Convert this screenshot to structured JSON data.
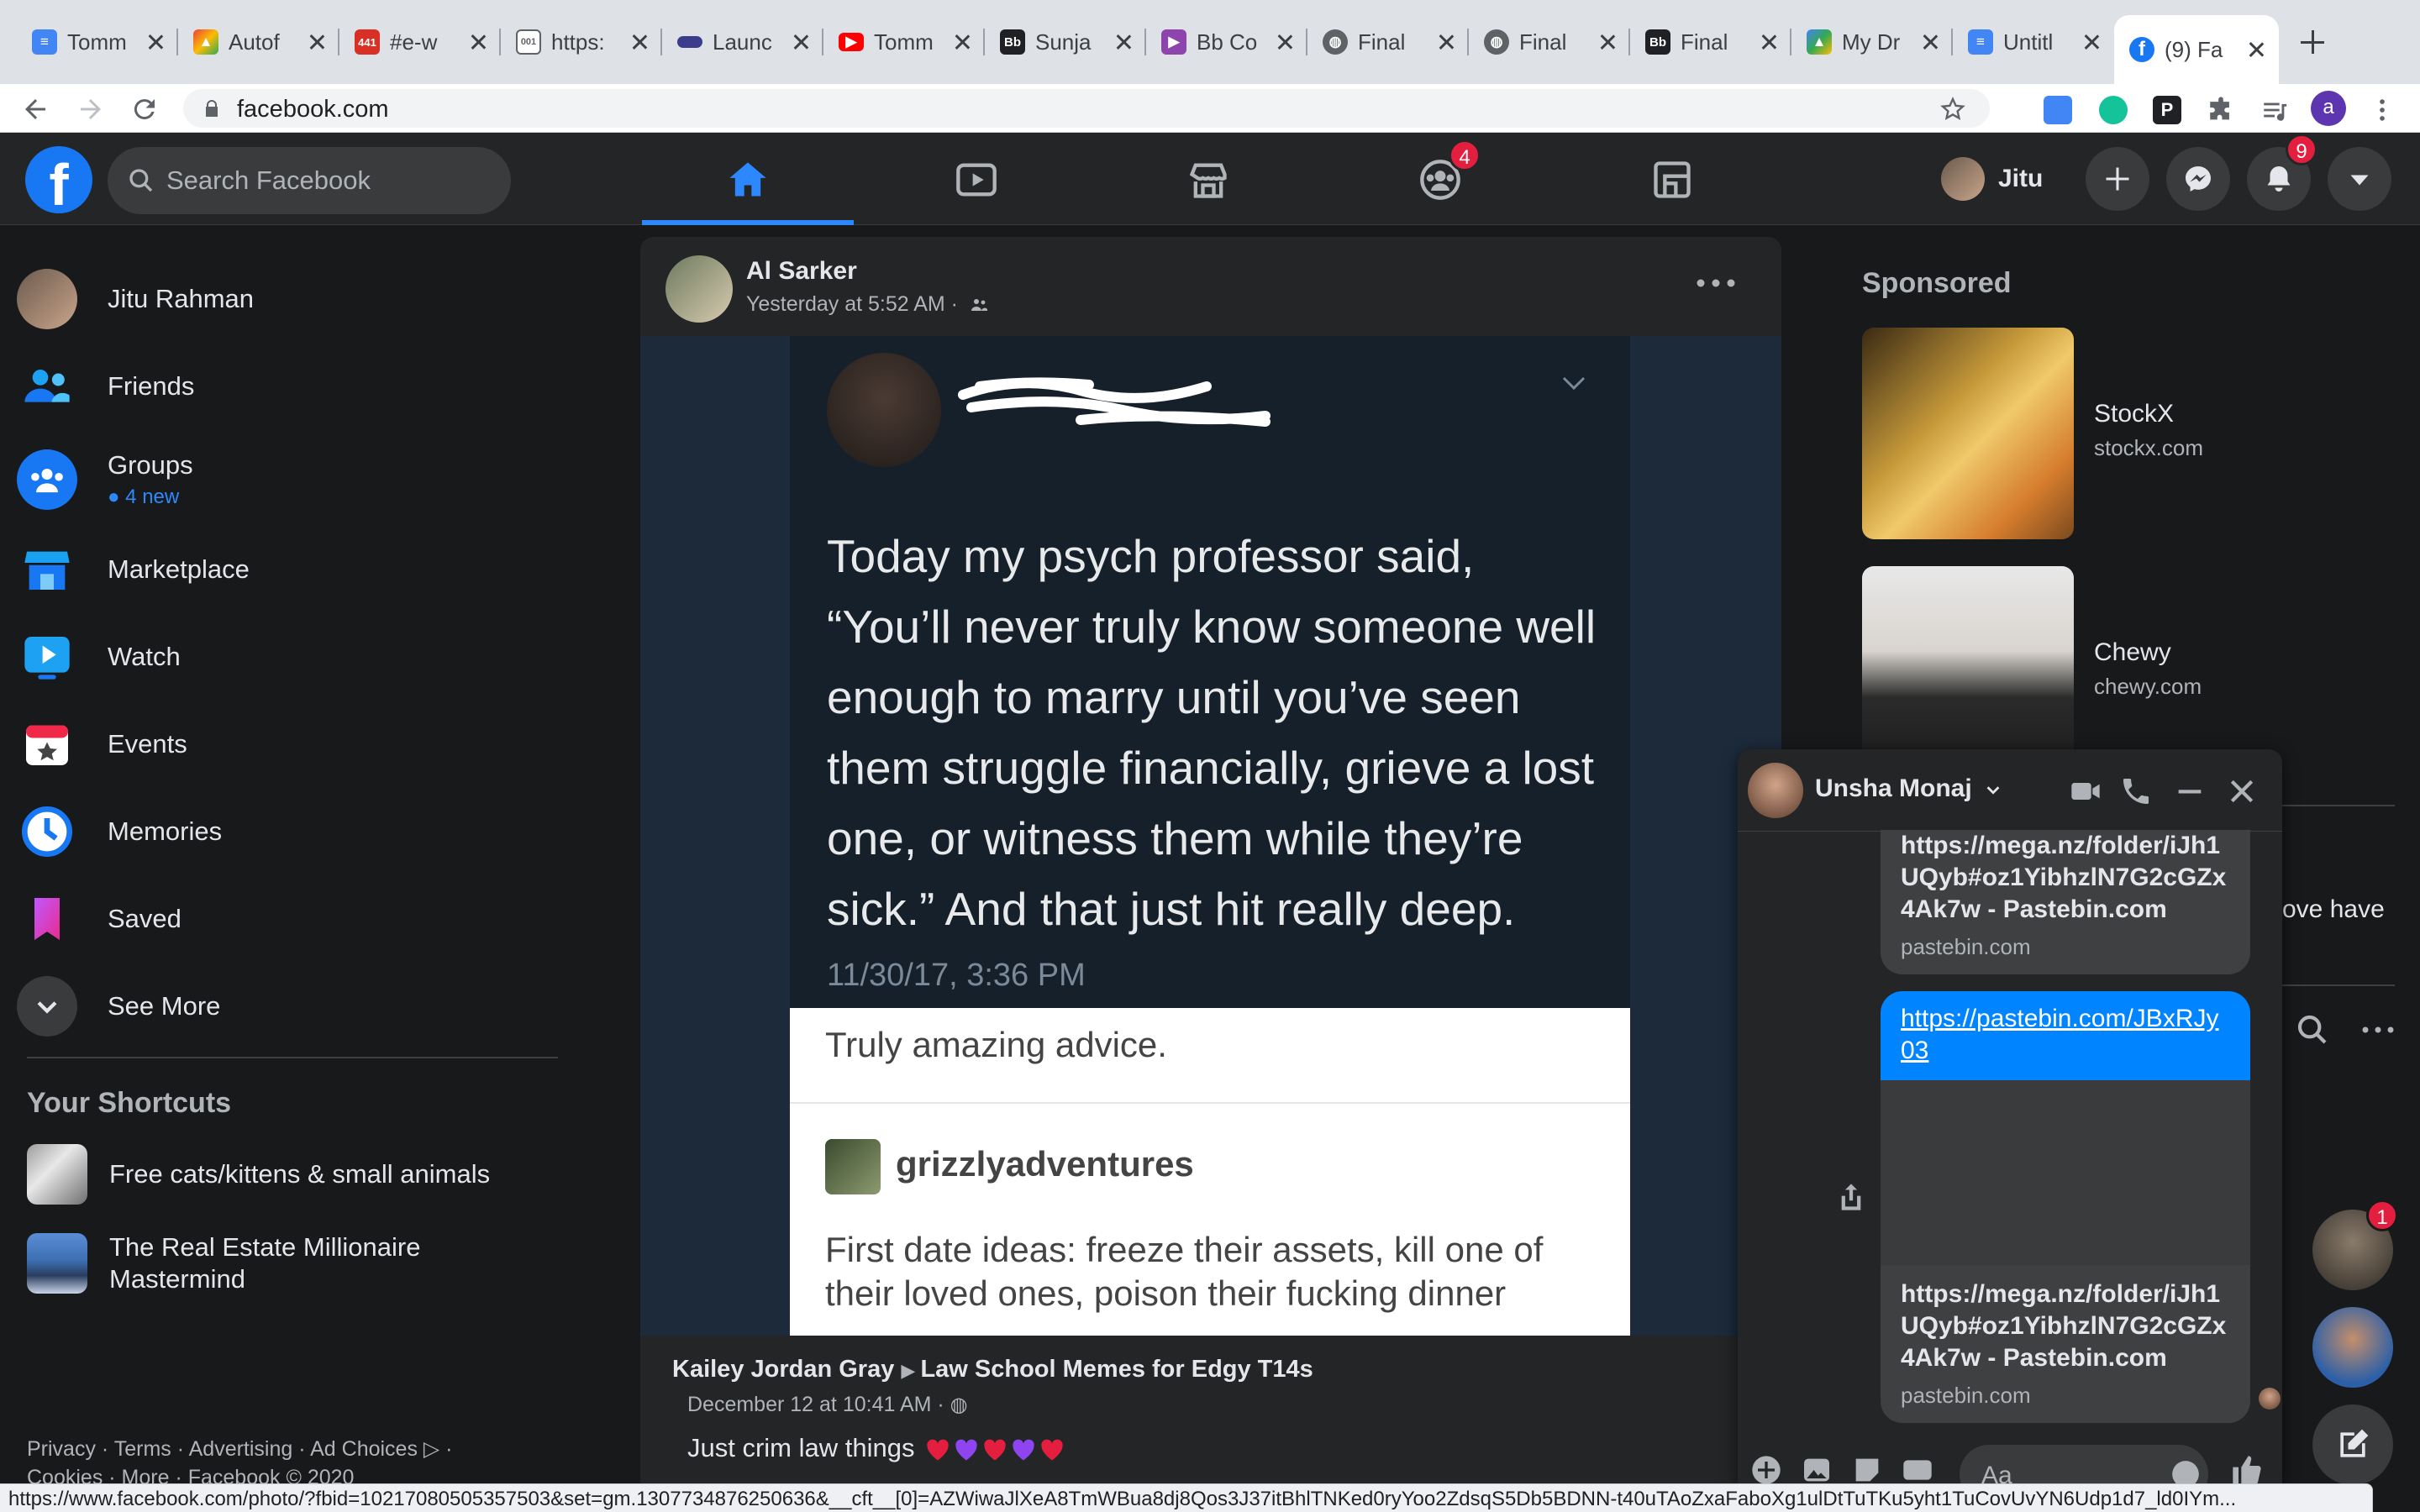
{
  "browser": {
    "tabs": [
      {
        "title": "Tomm",
        "favicon": "docs-icon",
        "color": "#4285f4"
      },
      {
        "title": "Autof",
        "favicon": "drive-icon",
        "color": "#ea4335"
      },
      {
        "title": "#e-w",
        "favicon": "calendar-icon",
        "color": "#d93025"
      },
      {
        "title": "https:",
        "favicon": "page-icon",
        "color": "#5f6368"
      },
      {
        "title": "Launc",
        "favicon": "launch-icon",
        "color": "#3c3c8c"
      },
      {
        "title": "Tomm",
        "favicon": "youtube-icon",
        "color": "#ff0000"
      },
      {
        "title": "Sunja",
        "favicon": "blackboard-icon",
        "color": "#202124"
      },
      {
        "title": "Bb Co",
        "favicon": "media-icon",
        "color": "#8e44ad"
      },
      {
        "title": "Final",
        "favicon": "globe-icon",
        "color": "#5f6368"
      },
      {
        "title": "Final",
        "favicon": "globe-icon",
        "color": "#5f6368"
      },
      {
        "title": "Final",
        "favicon": "blackboard-icon",
        "color": "#202124"
      },
      {
        "title": "My Dr",
        "favicon": "drive-icon",
        "color": "#34a853"
      },
      {
        "title": "Untitl",
        "favicon": "docs-icon",
        "color": "#4285f4"
      },
      {
        "title": "(9) Fa",
        "favicon": "facebook-icon",
        "color": "#1877f2"
      }
    ],
    "url": "facebook.com",
    "status_url": "https://www.facebook.com/photo/?fbid=10217080505357503&set=gm.1307734876250636&__cft__[0]=AZWiwaJlXeA8TmWBua8dj8Qos3J37itBhlTNKed0ryYoo2ZdsqS5Db5BDNN-t40uTAoZxaFaboXg1ulDtTuTKu5yht1TuCovUvYN6Udp1d7_ld0IYm..."
  },
  "nav": {
    "search_placeholder": "Search Facebook",
    "groups_badge": "4",
    "profile_name": "Jitu",
    "notifications_badge": "9"
  },
  "sidebar": {
    "profile": "Jitu Rahman",
    "items": [
      {
        "label": "Friends"
      },
      {
        "label": "Groups",
        "sub": "4 new"
      },
      {
        "label": "Marketplace"
      },
      {
        "label": "Watch"
      },
      {
        "label": "Events"
      },
      {
        "label": "Memories"
      },
      {
        "label": "Saved"
      },
      {
        "label": "See More"
      }
    ],
    "shortcuts_title": "Your Shortcuts",
    "shortcuts": [
      {
        "label": "Free cats/kittens & small animals"
      },
      {
        "label": "The Real Estate Millionaire Mastermind"
      }
    ],
    "footer": "Privacy · Terms · Advertising · Ad Choices ▷ · Cookies · More · Facebook © 2020"
  },
  "post": {
    "author": "Al Sarker",
    "meta": "Yesterday at 5:52 AM ·",
    "tweet_text": "Today my psych professor said, “You’ll never truly know someone well enough to marry until you’ve seen them struggle financially, grieve a lost one, or witness them while they’re sick.” And that just hit really deep.",
    "tweet_date": "11/30/17, 3:36 PM",
    "tumblr_caption": "Truly amazing advice.",
    "tumblr_user": "grizzlyadventures",
    "tumblr_body": "First date ideas: freeze their assets, kill one of their loved ones, poison their fucking dinner"
  },
  "next_post": {
    "author": "Kailey Jordan Gray",
    "group": "Law School Memes for Edgy T14s",
    "date": "December 12 at 10:41 AM ·",
    "text": "Just crim law things"
  },
  "right": {
    "sponsored_title": "Sponsored",
    "ads": [
      {
        "name": "StockX",
        "url": "stockx.com"
      },
      {
        "name": "Chewy",
        "url": "chewy.com"
      }
    ],
    "snippet": "ove have",
    "chathead_badge": "1"
  },
  "chat": {
    "name": "Unsha Monaj",
    "messages": [
      {
        "title": "https://mega.nz/folder/iJh1UQyb#oz1YibhzlN7G2cGZx4Ak7w - Pastebin.com",
        "domain": "pastebin.com"
      },
      {
        "link": "https://pastebin.com/JBxRJy03"
      },
      {
        "title": "https://mega.nz/folder/iJh1UQyb#oz1YibhzlN7G2cGZx4Ak7w - Pastebin.com",
        "domain": "pastebin.com"
      }
    ],
    "input_placeholder": "Aa"
  },
  "colors": {
    "fb_blue": "#1877f2",
    "active_tab": "#2d88ff",
    "badge_red": "#e41e3f",
    "messenger_blue": "#0084ff"
  }
}
